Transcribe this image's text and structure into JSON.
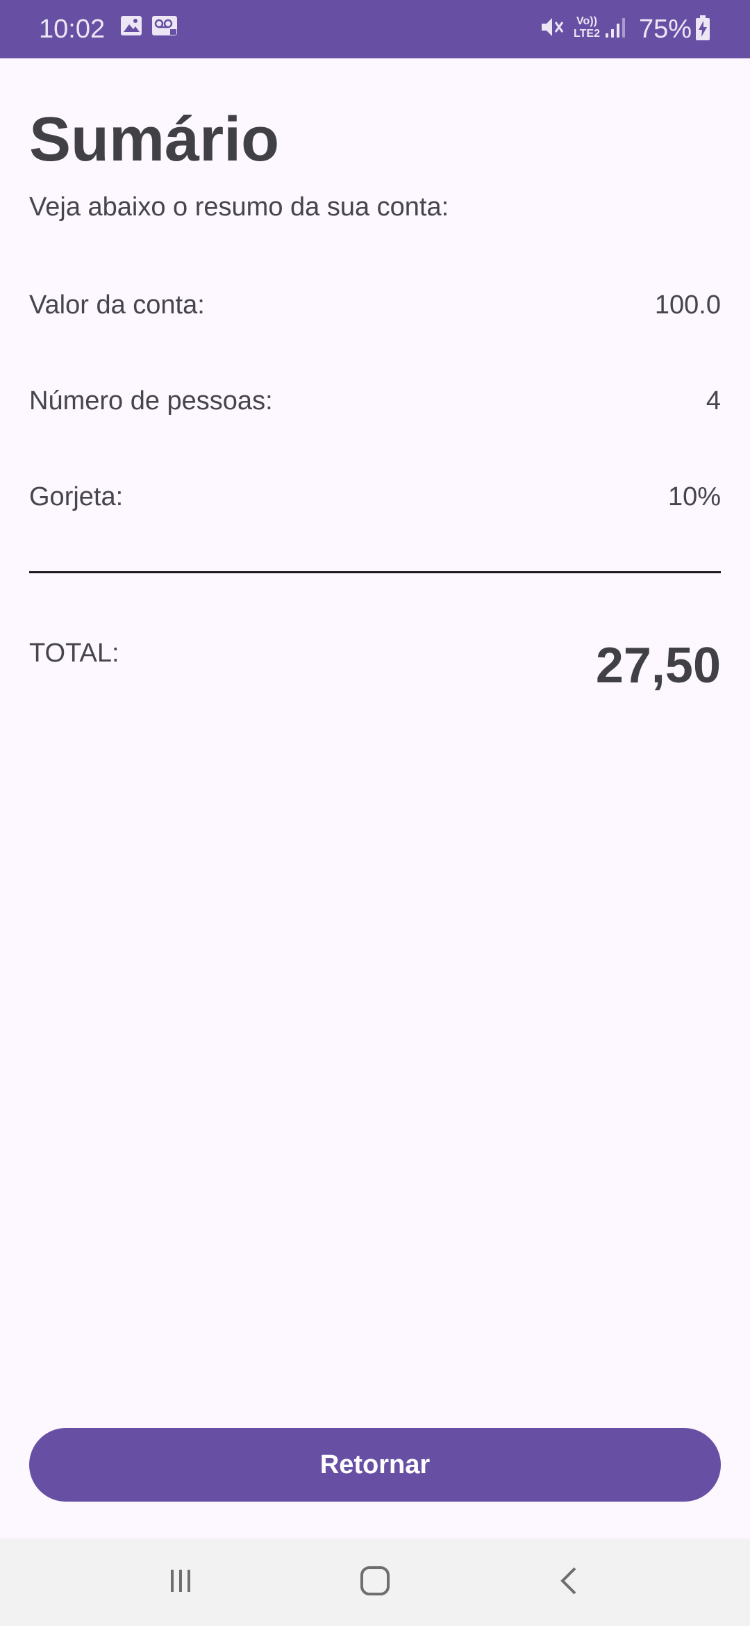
{
  "status_bar": {
    "time": "10:02",
    "battery": "75%",
    "icons": [
      "image-icon",
      "voicemail-icon",
      "mute-icon",
      "volte-icon",
      "signal-icon",
      "battery-charging-icon"
    ],
    "network_label_top": "Vo))",
    "network_label_bottom": "LTE2"
  },
  "summary": {
    "title": "Sumário",
    "subtitle": "Veja abaixo o resumo da sua conta:",
    "rows": [
      {
        "label": "Valor da conta:",
        "value": "100.0"
      },
      {
        "label": "Número de pessoas:",
        "value": "4"
      },
      {
        "label": "Gorjeta:",
        "value": "10%"
      }
    ],
    "total_label": "TOTAL:",
    "total_value": "27,50"
  },
  "actions": {
    "return_label": "Retornar"
  },
  "nav_bar": {
    "buttons": [
      "recent-apps-icon",
      "home-icon",
      "back-icon"
    ]
  },
  "colors": {
    "accent": "#6750A4",
    "background": "#FDF7FF",
    "text": "#46454B",
    "nav_background": "#F2F2F2"
  }
}
